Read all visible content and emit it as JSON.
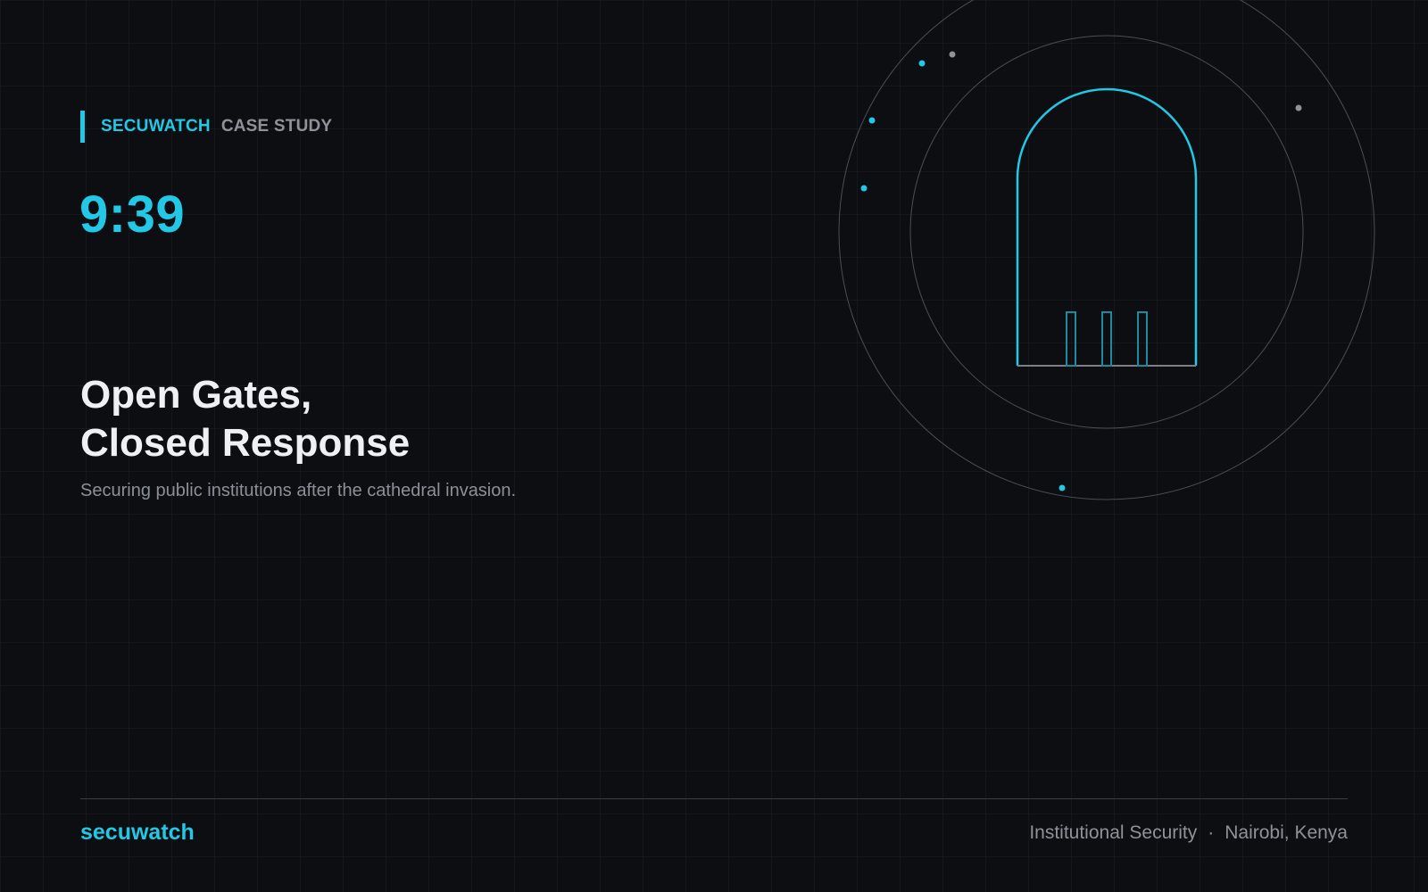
{
  "header": {
    "brand": "SECUWATCH",
    "tag": "CASE STUDY"
  },
  "episode": {
    "time": "9:39"
  },
  "hero": {
    "title_line_1": "Open Gates,",
    "title_line_2": "Closed Response",
    "subtitle": "Securing public institutions after the cathedral invasion."
  },
  "footer": {
    "brand": "secuwatch",
    "category": "Institutional Security",
    "separator": "·",
    "location": "Nairobi, Kenya"
  },
  "illustration": {
    "icon": "cathedral-gate-icon"
  },
  "colors": {
    "accent": "#22c8e5",
    "background": "#0c0e12",
    "muted": "#8e9299"
  }
}
